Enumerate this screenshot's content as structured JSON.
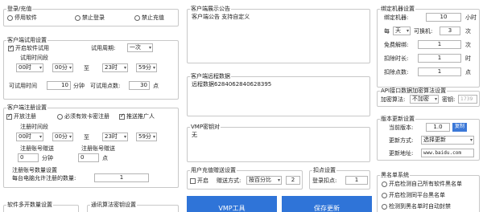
{
  "login": {
    "title": "登录/充值",
    "options": [
      "停用软件",
      "禁止登录",
      "禁止充值"
    ]
  },
  "trial": {
    "title": "客户端试用设置",
    "enable_label": "开启软件试用",
    "cycle_label": "试用周期:",
    "cycle_value": "一次",
    "period_title": "试用时间段",
    "start_hour": "00时",
    "start_min": "00分",
    "to_label": "至",
    "end_hour": "23时",
    "end_min": "59分",
    "duration_label": "可试用时间",
    "duration_value": "10",
    "minute_unit": "分钟",
    "points_label": "可试用点数:",
    "points_value": "30",
    "points_unit": "点"
  },
  "register": {
    "title": "客户端注册设置",
    "open_label": "开放注册",
    "must_recharge_label": "必须有效卡密注册",
    "promoter_label": "推送推广人",
    "period_title": "注册时间段",
    "start_hour": "00时",
    "start_min": "00分",
    "to_label": "至",
    "end_hour": "23时",
    "end_min": "59分",
    "gift_time_label": "注册账号赠送",
    "gift_time_value": "0",
    "gift_time_unit": "分钟",
    "gift_points_label": "注册账号赠送",
    "gift_points_value": "0",
    "gift_points_unit": "点",
    "limit_title": "注册账号数量设置",
    "limit_label": "每台电脑允许注册的数量:",
    "limit_value": "1"
  },
  "bottom_left": {
    "multi_open_title": "软件多开数量设置",
    "comm_title": "通讯算法密钥设置"
  },
  "notice": {
    "title": "客户端展示公告",
    "content": "客户端公告 支持自定义"
  },
  "remote": {
    "title": "客户端远程数据",
    "content": "远程数据6284062840628395"
  },
  "vmp": {
    "title": "VMP密钥对",
    "content": "无"
  },
  "ua": {
    "title": "用户充值赠送设置",
    "open_label": "开启",
    "gift_mode_label": "赠送方式:",
    "gift_mode_value": "按百分比",
    "value": "2"
  },
  "deduct": {
    "title": "扣点设置",
    "login_label": "登录扣点:",
    "login_value": "1"
  },
  "buttons": {
    "vmp_tool": "VMP工具",
    "save": "保存更新"
  },
  "bind": {
    "title": "绑定机器设置",
    "bind_period_label": "绑定机器:",
    "bind_period_value": "10",
    "bind_period_unit": "小时",
    "every_label": "每",
    "every_value": "天",
    "allow_label": "可换机:",
    "allow_value": "3",
    "allow_unit": "次",
    "free_label": "免费解绑:",
    "free_value": "1",
    "free_unit": "次",
    "deduct_time_label": "扣除时长:",
    "deduct_time_value": "1",
    "deduct_time_unit": "时",
    "deduct_points_label": "扣除点数:",
    "deduct_points_value": "1",
    "deduct_points_unit": "点"
  },
  "api": {
    "title": "API接口数据加密算法设置",
    "algo_label": "加密算法:",
    "algo_value": "不加密",
    "key_label": "密钥:",
    "key_value": "1739"
  },
  "version": {
    "title": "版本更新设置",
    "current_label": "当前版本:",
    "current_value": "1.0",
    "copy_label": "复制",
    "mode_label": "更新方式:",
    "mode_value": "选择更新",
    "url_label": "更新地址:",
    "url_value": "www.baidu.com"
  },
  "blacklist": {
    "title": "黑名单系统",
    "options": [
      "开启检测自己所有软件黑名单",
      "开启检测同平台黑名单",
      "检测到黑名单时自动封禁"
    ]
  }
}
